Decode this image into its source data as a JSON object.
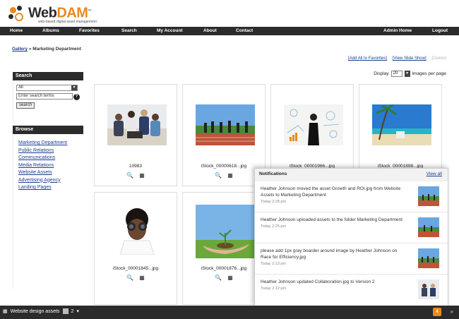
{
  "header": {
    "logo_web": "Web",
    "logo_dam": "DAM",
    "tagline": "web-based digital asset management"
  },
  "nav": {
    "home": "Home",
    "albums": "Albums",
    "favorites": "Favorites",
    "search": "Search",
    "my_account": "My Account",
    "about": "About",
    "contact": "Contact",
    "admin_home": "Admin Home",
    "logout": "Logout"
  },
  "breadcrumb": {
    "gallery": "Gallery",
    "separator": "»",
    "current": "Marketing Department"
  },
  "top_links": {
    "add_all": "[Add All to Favorites]",
    "slide_show": "[View Slide Show]",
    "disabled": "[Delete]"
  },
  "display": {
    "label": "Display",
    "value": "20",
    "suffix": "images per page"
  },
  "sidebar": {
    "search_title": "Search",
    "select_value": "All",
    "search_placeholder": "Enter search terms",
    "search_button": "search",
    "browse_title": "Browse",
    "browse_items": [
      "Marketing Department",
      "Public Relations",
      "Communications",
      "Media Relations",
      "Website Assets",
      "Advertising Agency",
      "Landing Pages"
    ]
  },
  "grid": {
    "items": [
      {
        "name": "10983"
      },
      {
        "name": "iStock_00000618...jpg"
      },
      {
        "name": "iStock_00001966...jpg"
      },
      {
        "name": "iStock_00001898...jpg"
      },
      {
        "name": "iStock_00001845...jpg"
      },
      {
        "name": "iStock_00001876...jpg"
      }
    ]
  },
  "notifications": {
    "title": "Notifications",
    "view_all": "View all",
    "items": [
      {
        "msg": "Heather Johnson moved the asset Growth and ROI.jpg from Website Assets to Marketing Department",
        "time": "Today 2:28 pm"
      },
      {
        "msg": "Heather Johnson uploaded assets to the folder Marketing Department",
        "time": "Today 2:25 pm"
      },
      {
        "msg": "please add 1px gray boarder around image by Heather Johnson on Race for Efficiency.jpg",
        "time": "Today 2:13 pm"
      },
      {
        "msg": "Heather Johnson updated Collaboration.jpg to Version 2",
        "time": "Today 2:12 pm"
      }
    ]
  },
  "bottombar": {
    "label": "Website design assets",
    "count": "2",
    "badge": "4",
    "arrow": "»"
  },
  "colors": {
    "accent": "#e98a1d",
    "nav_bg": "#2b2b2b",
    "link": "#1a3d8f"
  }
}
